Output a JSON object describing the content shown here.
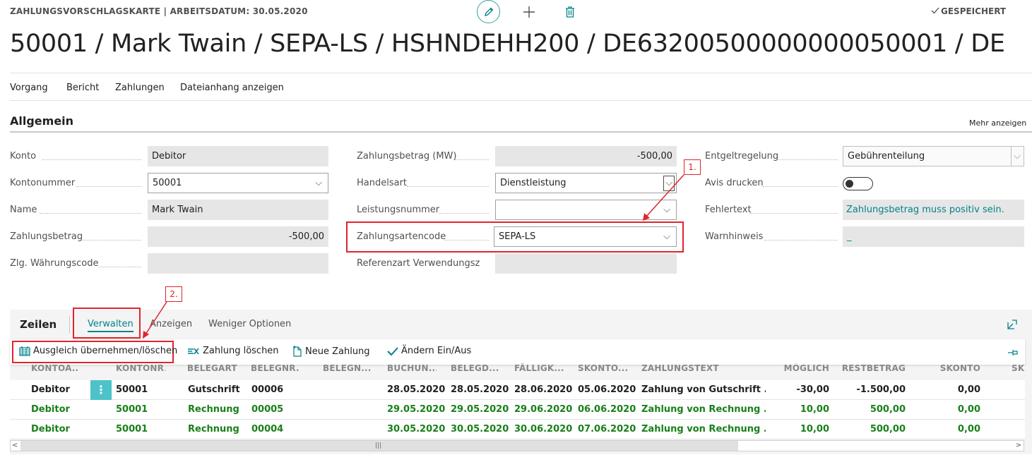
{
  "header": {
    "caption": "ZAHLUNGSVORSCHLAGSKARTE | ARBEITSDATUM: 30.05.2020",
    "saved": "GESPEICHERT",
    "title": "50001 / Mark Twain / SEPA-LS / HSHNDEHH200 / DE63200500000000050001 / DE"
  },
  "menu": [
    "Vorgang",
    "Bericht",
    "Zahlungen",
    "Dateianhang anzeigen"
  ],
  "general": {
    "title": "Allgemein",
    "more": "Mehr anzeigen",
    "col1": [
      {
        "label": "Konto",
        "value": "Debitor"
      },
      {
        "label": "Kontonummer",
        "value": "50001"
      },
      {
        "label": "Name",
        "value": "Mark Twain"
      },
      {
        "label": "Zahlungsbetrag",
        "value": "-500,00"
      },
      {
        "label": "Zlg. Währungscode",
        "value": ""
      }
    ],
    "col2": [
      {
        "label": "Zahlungsbetrag (MW)",
        "value": "-500,00"
      },
      {
        "label": "Handelsart",
        "value": "Dienstleistung"
      },
      {
        "label": "Leistungsnummer",
        "value": ""
      },
      {
        "label": "Zahlungsartencode",
        "value": "SEPA-LS"
      },
      {
        "label": "Referenzart Verwendungsz...",
        "value": ""
      }
    ],
    "col3": [
      {
        "label": "Entgeltregelung",
        "value": "Gebührenteilung"
      },
      {
        "label": "Avis drucken",
        "value": ""
      },
      {
        "label": "Fehlertext",
        "value": "Zahlungsbetrag muss positiv sein."
      },
      {
        "label": "Warnhinweis",
        "value": "_"
      }
    ]
  },
  "annotations": {
    "one": "1.",
    "two": "2."
  },
  "lines": {
    "title": "Zeilen",
    "tabs": [
      "Verwalten",
      "Anzeigen",
      "Weniger Optionen"
    ],
    "actions": [
      "Ausgleich übernehmen/löschen",
      "Zahlung löschen",
      "Neue Zahlung",
      "Ändern Ein/Aus"
    ],
    "columns": [
      "KONTOA...",
      "KONTONR.",
      "BELEGART",
      "BELEGNR.",
      "BELEGN...",
      "BUCHUN...",
      "BELEGD...",
      "FÄLLIGK...",
      "SKONTO...",
      "ZAHLUNGSTEXT",
      "MÖGLICH",
      "RESTBETRAG",
      "SKONTO",
      "SK"
    ],
    "rows": [
      {
        "kontoart": "Debitor",
        "kontonr": "50001",
        "belegart": "Gutschrift",
        "belegnr": "00006",
        "buchung": "28.05.2020",
        "belegd": "28.05.2020",
        "faellig": "28.06.2020",
        "skontod": "05.06.2020",
        "text": "Zahlung von Gutschrift ...",
        "moeglich": "-30,00",
        "rest": "-1.500,00",
        "skonto": "0,00"
      },
      {
        "kontoart": "Debitor",
        "kontonr": "50001",
        "belegart": "Rechnung",
        "belegnr": "00005",
        "buchung": "29.05.2020",
        "belegd": "29.05.2020",
        "faellig": "29.06.2020",
        "skontod": "06.06.2020",
        "text": "Zahlung von Rechnung ...",
        "moeglich": "10,00",
        "rest": "500,00",
        "skonto": "0,00"
      },
      {
        "kontoart": "Debitor",
        "kontonr": "50001",
        "belegart": "Rechnung",
        "belegnr": "00004",
        "buchung": "30.05.2020",
        "belegd": "30.05.2020",
        "faellig": "30.06.2020",
        "skontod": "07.06.2020",
        "text": "Zahlung von Rechnung ...",
        "moeglich": "10,00",
        "rest": "500,00",
        "skonto": "0,00"
      }
    ]
  }
}
